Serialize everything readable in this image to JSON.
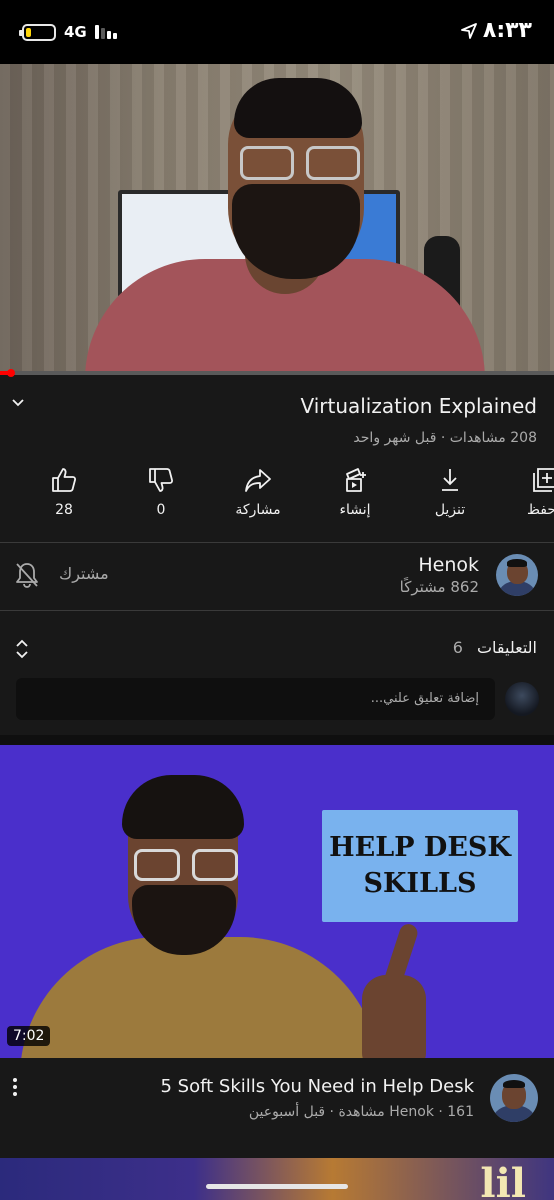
{
  "status_bar": {
    "time": "٨:٣٣",
    "network": "4G",
    "battery_level": 0.2,
    "signal_bars": 2
  },
  "player": {
    "progress": 0.02,
    "progress_color": "#ff0000"
  },
  "video": {
    "title": "Virtualization Explained",
    "meta": "208 مشاهدات · قبل شهر واحد"
  },
  "actions": {
    "like_count": "28",
    "dislike_count": "0",
    "share_label": "مشاركة",
    "create_label": "إنشاء",
    "download_label": "تنزيل",
    "save_label": "حفظ"
  },
  "channel": {
    "name": "Henok",
    "subscribers": "862 مشتركًا",
    "subscribed_label": "مشترك"
  },
  "comments": {
    "label": "التعليقات",
    "count": "6",
    "placeholder": "إضافة تعليق علني..."
  },
  "recommended": {
    "thumbnail_text_line1": "HELP DESK",
    "thumbnail_text_line2": "SKILLS",
    "duration": "7:02",
    "title": "5 Soft Skills You Need in Help Desk",
    "meta": "Henok · 161 مشاهدة · قبل أسبوعين"
  },
  "next_thumbnail_text": "lil",
  "colors": {
    "background": "#181818",
    "text_primary": "#f1f1f1",
    "text_secondary": "#aaaaaa",
    "thumbnail_bg": "#4a2fcb",
    "sign_bg": "#79b2ee"
  }
}
